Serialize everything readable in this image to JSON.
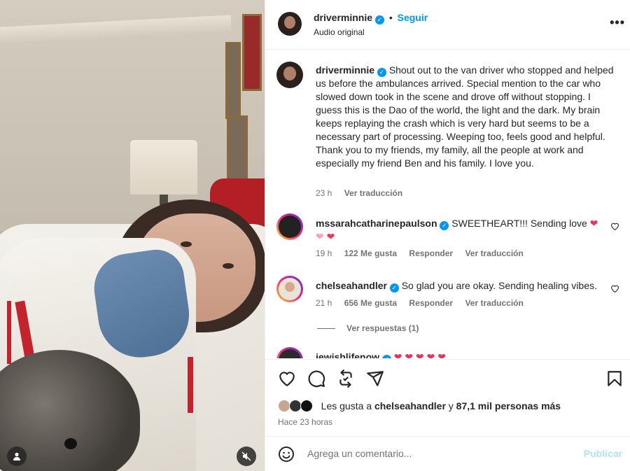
{
  "post": {
    "author": "driverminnie",
    "follow_label": "Seguir",
    "separator": "•",
    "audio_label": "Audio original",
    "more_label": "•••"
  },
  "caption": {
    "author": "driverminnie",
    "text": "Shout out to the van driver who stopped and helped us before the ambulances arrived. Special mention to the car who slowed down took in the scene and drove off without stopping. I guess this is the Dao of the world, the light and the dark. My brain keeps replaying the crash which is very hard but seems to be a necessary part of processing. Weeping too, feels good and helpful. Thank you to my friends, my family, all the people at work and especially my friend Ben and his family. I love you.",
    "time": "23 h",
    "translate": "Ver traducción"
  },
  "comments": [
    {
      "author": "mssarahcatharinepaulson",
      "text": "SWEETHEART!!! Sending love",
      "time": "19 h",
      "likes": "122 Me gusta",
      "reply": "Responder",
      "translate": "Ver traducción"
    },
    {
      "author": "chelseahandler",
      "text": "So glad you are okay. Sending healing vibes.",
      "time": "21 h",
      "likes": "656 Me gusta",
      "reply": "Responder",
      "translate": "Ver traducción",
      "view_replies": "Ver respuestas (1)"
    },
    {
      "author": "jewishlifenow",
      "text": ""
    }
  ],
  "likes": {
    "prefix": "Les gusta a ",
    "user": "chelseahandler",
    "middle": " y ",
    "others": "87,1 mil personas más"
  },
  "timestamp": "Hace 23 horas",
  "compose": {
    "placeholder": "Agrega un comentario...",
    "publish": "Publicar"
  },
  "colors": {
    "accent": "#0095f6",
    "heart": "#ed3254",
    "muted": "#737373",
    "publish_disabled": "#b2dffc"
  },
  "icons": [
    "heart-icon",
    "comment-icon",
    "repost-icon",
    "share-icon",
    "bookmark-icon",
    "emoji-icon",
    "user-tag-icon",
    "mute-icon",
    "verified-icon"
  ]
}
